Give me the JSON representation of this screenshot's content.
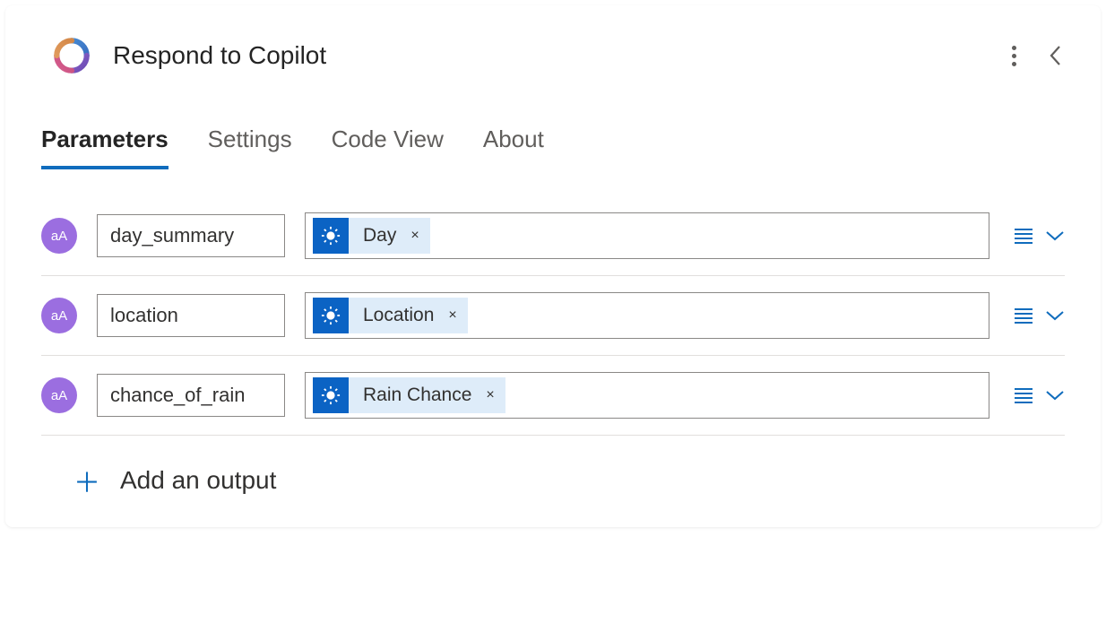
{
  "header": {
    "title": "Respond to Copilot"
  },
  "tabs": {
    "parameters": "Parameters",
    "settings": "Settings",
    "code_view": "Code View",
    "about": "About",
    "active": "parameters"
  },
  "type_badge_text": "aA",
  "parameters": [
    {
      "name": "day_summary",
      "token_label": "Day"
    },
    {
      "name": "location",
      "token_label": "Location"
    },
    {
      "name": "chance_of_rain",
      "token_label": "Rain Chance"
    }
  ],
  "add_output_label": "Add an output",
  "token_remove_glyph": "×"
}
